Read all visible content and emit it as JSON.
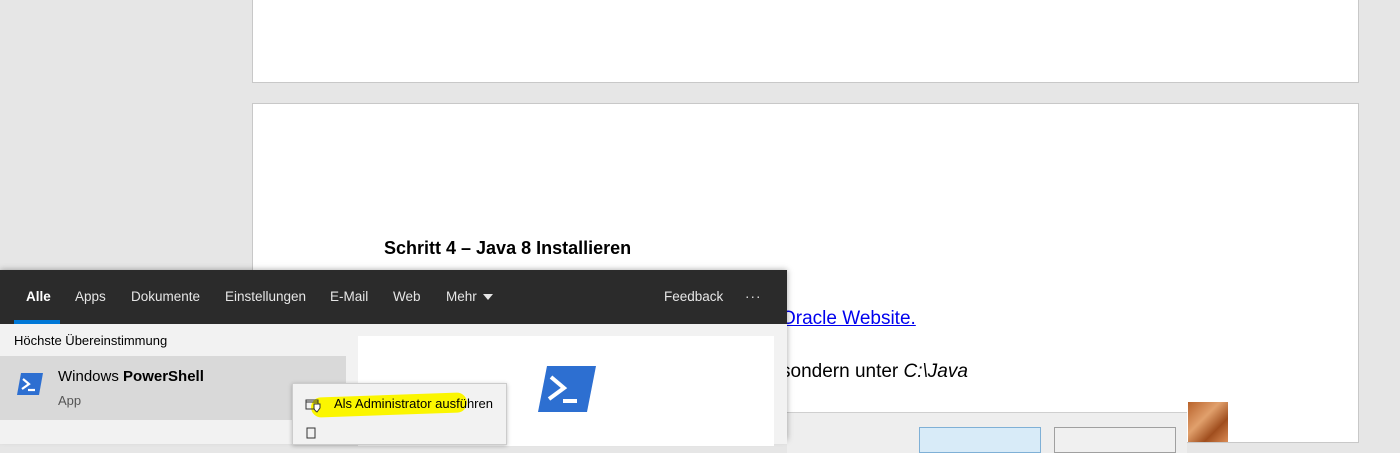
{
  "document": {
    "heading": "Schritt 4 – Java 8 Installieren",
    "link_text": "Oracle Website.",
    "line_prefix": "sondern unter ",
    "line_path": "C:\\Java"
  },
  "search": {
    "tabs": [
      "Alle",
      "Apps",
      "Dokumente",
      "Einstellungen",
      "E-Mail",
      "Web",
      "Mehr"
    ],
    "feedback_label": "Feedback",
    "more_options_label": "···",
    "section_label": "Höchste Übereinstimmung",
    "best_match": {
      "title_prefix": "Windows ",
      "title_bold": "PowerShell",
      "subtitle": "App",
      "icon": "powershell-icon"
    }
  },
  "context_menu": {
    "items": [
      {
        "label": "Als Administrator ausführen",
        "icon": "shield-icon",
        "highlighted": true
      }
    ]
  },
  "colors": {
    "accent": "#0078d7",
    "tab_bar": "#2b2b2b",
    "highlight": "#fbf600",
    "link": "#0000ee"
  }
}
